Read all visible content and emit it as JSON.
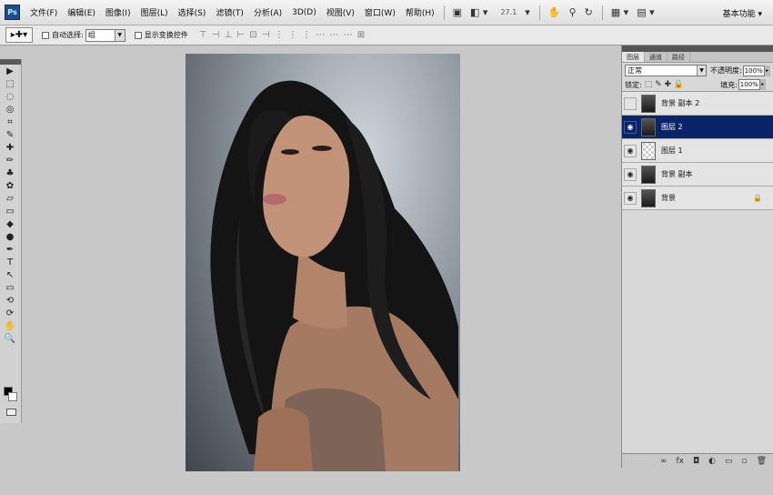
{
  "app": {
    "logo": "Ps"
  },
  "menu": {
    "items": [
      "文件(F)",
      "编辑(E)",
      "图像(I)",
      "图层(L)",
      "选择(S)",
      "滤镜(T)",
      "分析(A)",
      "3D(D)",
      "视图(V)",
      "窗口(W)",
      "帮助(H)"
    ],
    "zoom": "27.1",
    "workspace": "基本功能 ▾"
  },
  "options": {
    "auto_select_label": "自动选择:",
    "auto_select_value": "组",
    "show_transform_label": "显示变换控件",
    "align_icons": "⊤ ⊣ ⊥  ⊢ ⊡ ⊣   ⋮ ⋮ ⋮  ⋯ ⋯ ⋯   ⊞"
  },
  "toolbox": {
    "tools": [
      "move-icon",
      "marquee-icon",
      "lasso-icon",
      "quick-select-icon",
      "crop-icon",
      "eyedropper-icon",
      "healing-icon",
      "brush-icon",
      "clone-stamp-icon",
      "history-brush-icon",
      "eraser-icon",
      "gradient-icon",
      "blur-icon",
      "dodge-icon",
      "pen-icon",
      "type-icon",
      "path-select-icon",
      "shape-icon",
      "3d-rotate-icon",
      "3d-orbit-icon",
      "hand-icon",
      "zoom-icon"
    ],
    "glyphs": [
      "▶",
      "⬚",
      "◌",
      "◎",
      "⌗",
      "✎",
      "✚",
      "✏",
      "♣",
      "✿",
      "▱",
      "▭",
      "◆",
      "●",
      "✒",
      "T",
      "↖",
      "▭",
      "⟲",
      "⟳",
      "✋",
      "🔍"
    ]
  },
  "layers_panel": {
    "tabs": [
      "图层",
      "通道",
      "路径"
    ],
    "blend_mode": "正常",
    "opacity_label": "不透明度:",
    "opacity_value": "100%",
    "lock_label": "锁定:",
    "lock_icons": "⬚ ✎ ✚ 🔒",
    "fill_label": "填充:",
    "fill_value": "100%",
    "layers": [
      {
        "name": "背景 副本 2",
        "visible": false,
        "selected": false,
        "thumb": "photo"
      },
      {
        "name": "图层 2",
        "visible": true,
        "selected": true,
        "thumb": "photo"
      },
      {
        "name": "图层 1",
        "visible": true,
        "selected": false,
        "thumb": "transparent"
      },
      {
        "name": "背景 副本",
        "visible": true,
        "selected": false,
        "thumb": "photo"
      },
      {
        "name": "背景",
        "visible": true,
        "selected": false,
        "thumb": "photo",
        "locked": true
      }
    ],
    "footer_icons": [
      "link-icon",
      "fx-icon",
      "mask-icon",
      "adjustment-icon",
      "group-icon",
      "new-layer-icon",
      "trash-icon"
    ],
    "footer_glyphs": [
      "∞",
      "fx",
      "◘",
      "◐",
      "▭",
      "▫",
      "🗑"
    ]
  }
}
